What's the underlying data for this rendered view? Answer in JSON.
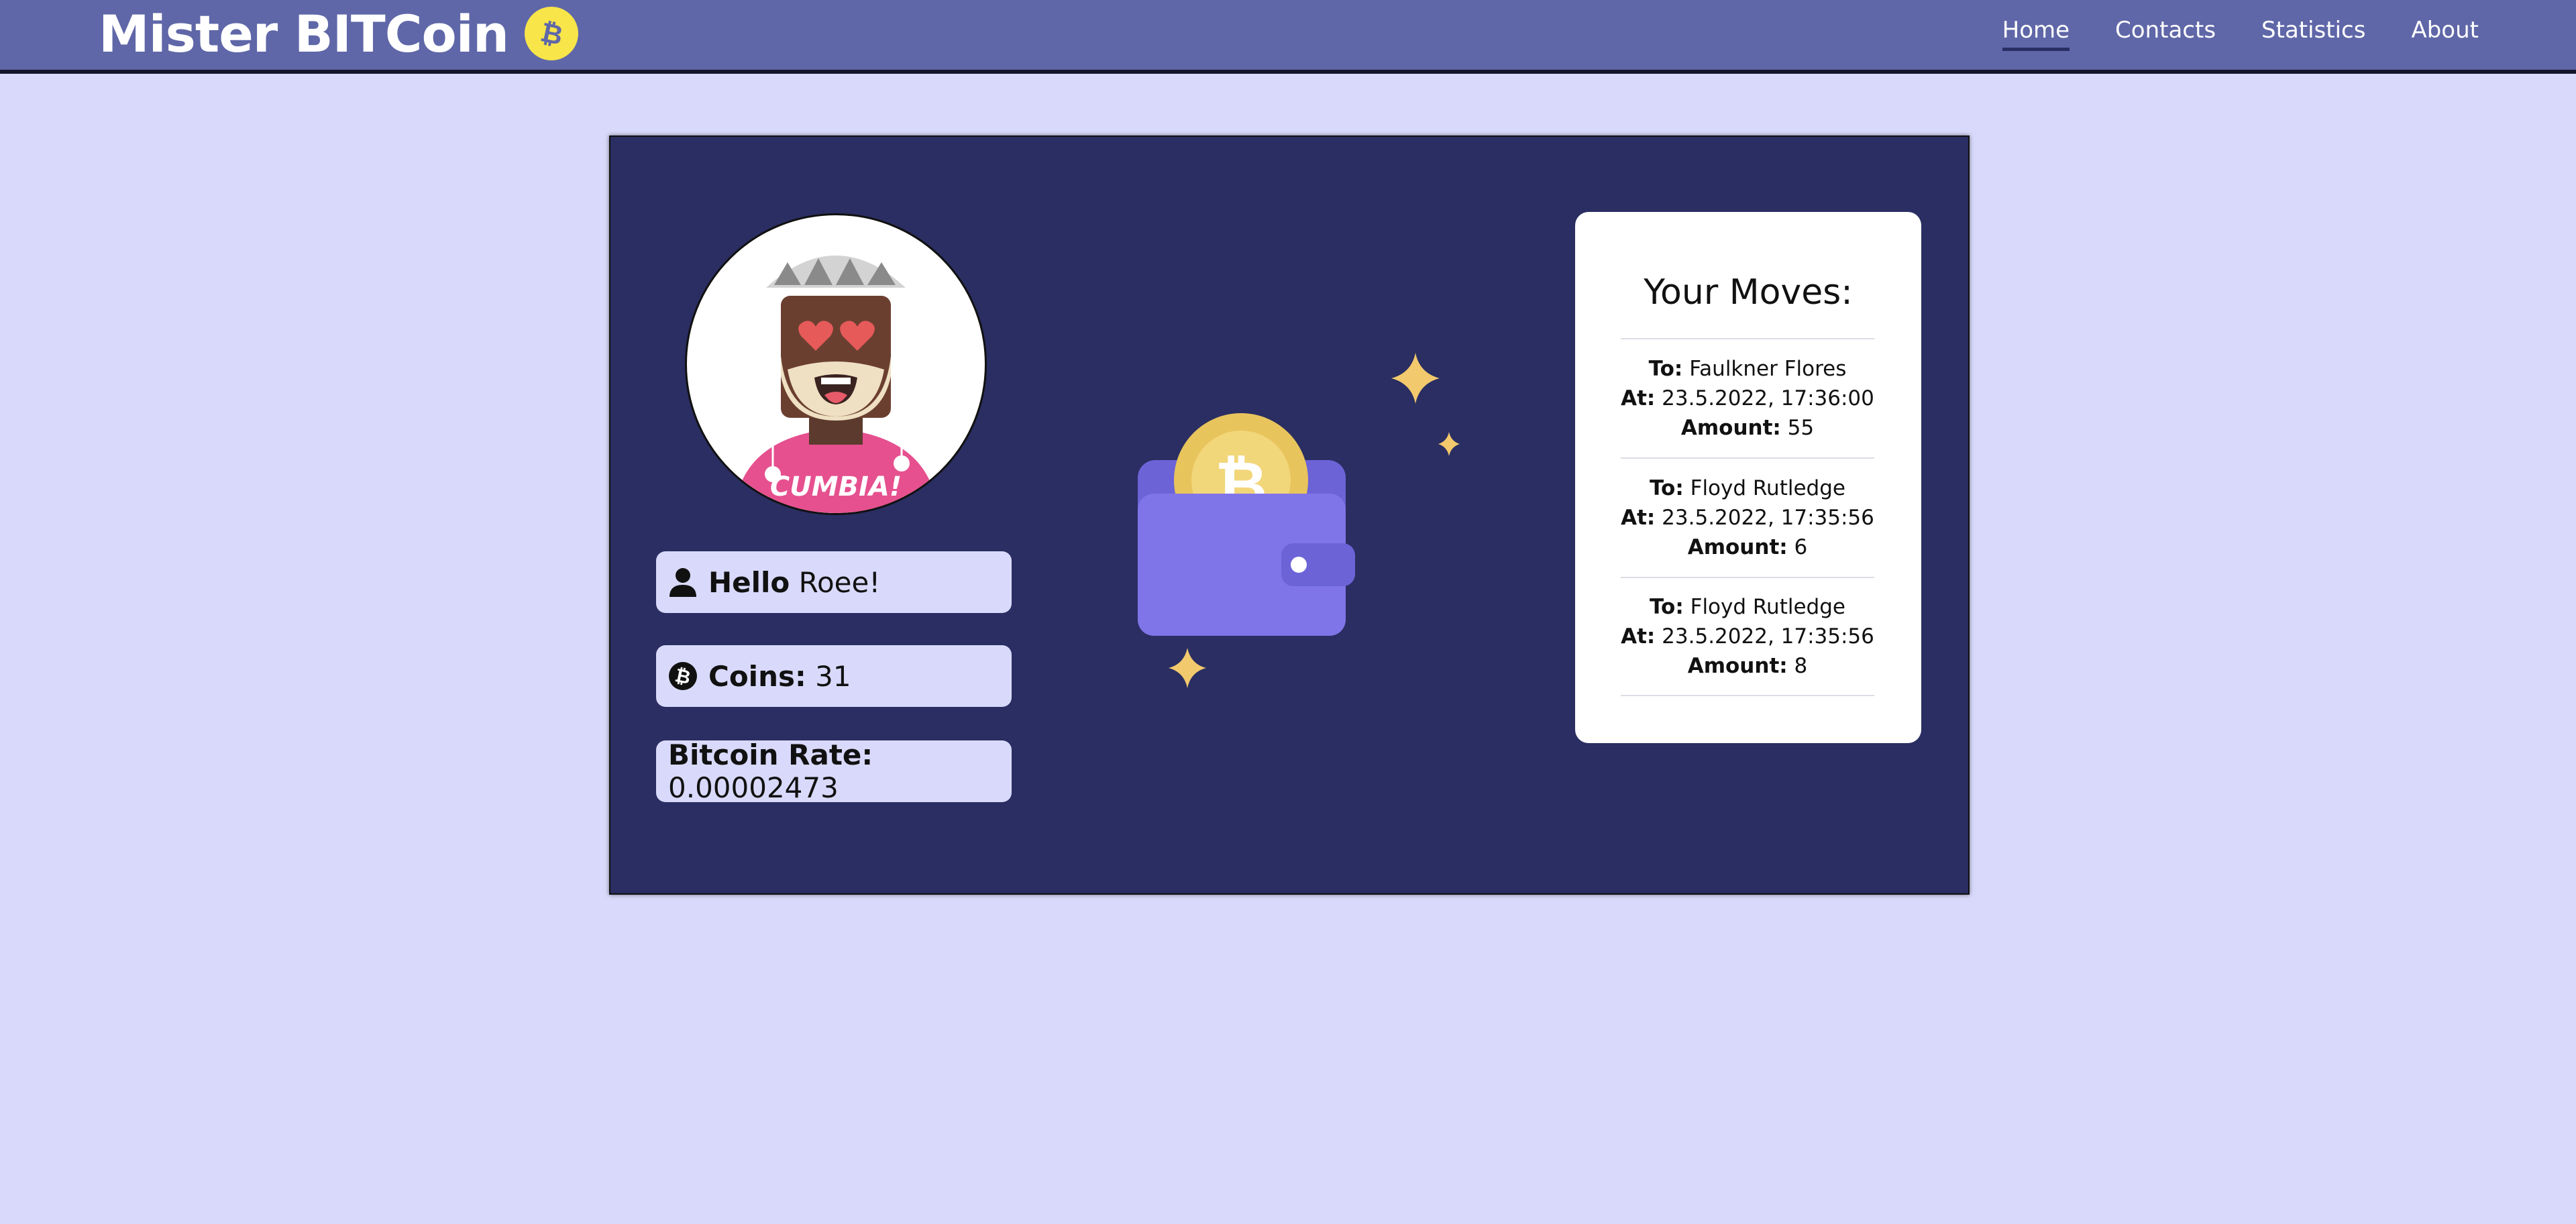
{
  "header": {
    "brand": "Mister BITCoin",
    "brand_icon": "bitcoin-icon",
    "nav": [
      {
        "label": "Home",
        "active": true
      },
      {
        "label": "Contacts"
      },
      {
        "label": "Statistics"
      },
      {
        "label": "About"
      }
    ]
  },
  "user": {
    "hello_label": "Hello",
    "name": "Roee!",
    "coins_label": "Coins:",
    "coins": "31",
    "rate_label": "Bitcoin Rate:",
    "rate": "0.00002473",
    "shirt_text": "CUMBIA!"
  },
  "moves": {
    "title": "Your Moves:",
    "to_label": "To:",
    "at_label": "At:",
    "amount_label": "Amount:",
    "items": [
      {
        "to": "Faulkner Flores",
        "at": "23.5.2022, 17:36:00",
        "amount": "55"
      },
      {
        "to": "Floyd Rutledge",
        "at": "23.5.2022, 17:35:56",
        "amount": "6"
      },
      {
        "to": "Floyd Rutledge",
        "at": "23.5.2022, 17:35:56",
        "amount": "8"
      }
    ]
  },
  "colors": {
    "header_bg": "#5f67a8",
    "page_bg": "#d9dafb",
    "card_bg": "#2a2e62",
    "accent_yellow": "#f7e54a",
    "wallet": "#8075e8"
  }
}
